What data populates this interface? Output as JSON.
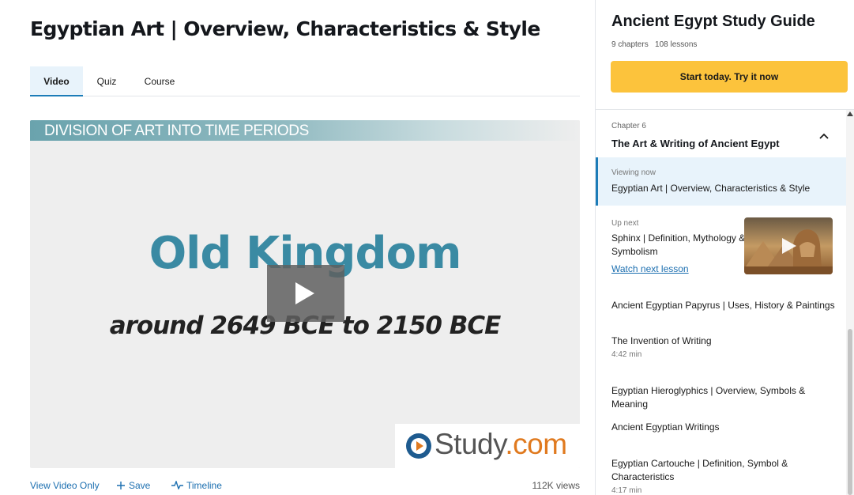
{
  "lesson": {
    "title": "Egyptian Art | Overview, Characteristics & Style"
  },
  "tabs": [
    {
      "label": "Video",
      "active": true
    },
    {
      "label": "Quiz",
      "active": false
    },
    {
      "label": "Course",
      "active": false
    }
  ],
  "video": {
    "banner": "DIVISION OF ART INTO TIME PERIODS",
    "heading": "Old Kingdom",
    "subheading": "around 2649 BCE to 2150 BCE",
    "watermark_brand": "Study",
    "watermark_tld": ".com"
  },
  "video_actions": {
    "view_only": "View Video Only",
    "save": "Save",
    "timeline": "Timeline",
    "views": "112K views"
  },
  "sidebar": {
    "title": "Ancient Egypt Study Guide",
    "chapters_count": "9 chapters",
    "lessons_count": "108 lessons",
    "cta": "Start today. Try it now",
    "chapter_label": "Chapter 6",
    "chapter_name": "The Art & Writing of Ancient Egypt",
    "viewing_label": "Viewing now",
    "viewing_title": "Egyptian Art | Overview, Characteristics & Style",
    "upnext_label": "Up next",
    "upnext_title": "Sphinx | Definition, Mythology & Symbolism",
    "upnext_link": "Watch next lesson",
    "lessons": [
      {
        "title": "Ancient Egyptian Papyrus | Uses, History & Paintings",
        "duration": ""
      },
      {
        "title": "The Invention of Writing",
        "duration": "4:42 min"
      },
      {
        "title": "Egyptian Hieroglyphics | Overview, Symbols & Meaning",
        "duration": ""
      },
      {
        "title": "Ancient Egyptian Writings",
        "duration": ""
      },
      {
        "title": "Egyptian Cartouche | Definition, Symbol & Characteristics",
        "duration": "4:17 min"
      }
    ]
  },
  "colors": {
    "accent_blue": "#1c7cb8",
    "link_blue": "#1c6fb0",
    "cta_yellow": "#fcc33c",
    "active_bg": "#e8f3fb",
    "heading_teal": "#3a8aa3",
    "brand_orange": "#e07a1f"
  },
  "icons": {
    "play": "play-icon",
    "save": "plus-icon",
    "timeline": "timeline-icon",
    "chevron": "chevron-up-icon",
    "logo": "study-logo-icon"
  }
}
